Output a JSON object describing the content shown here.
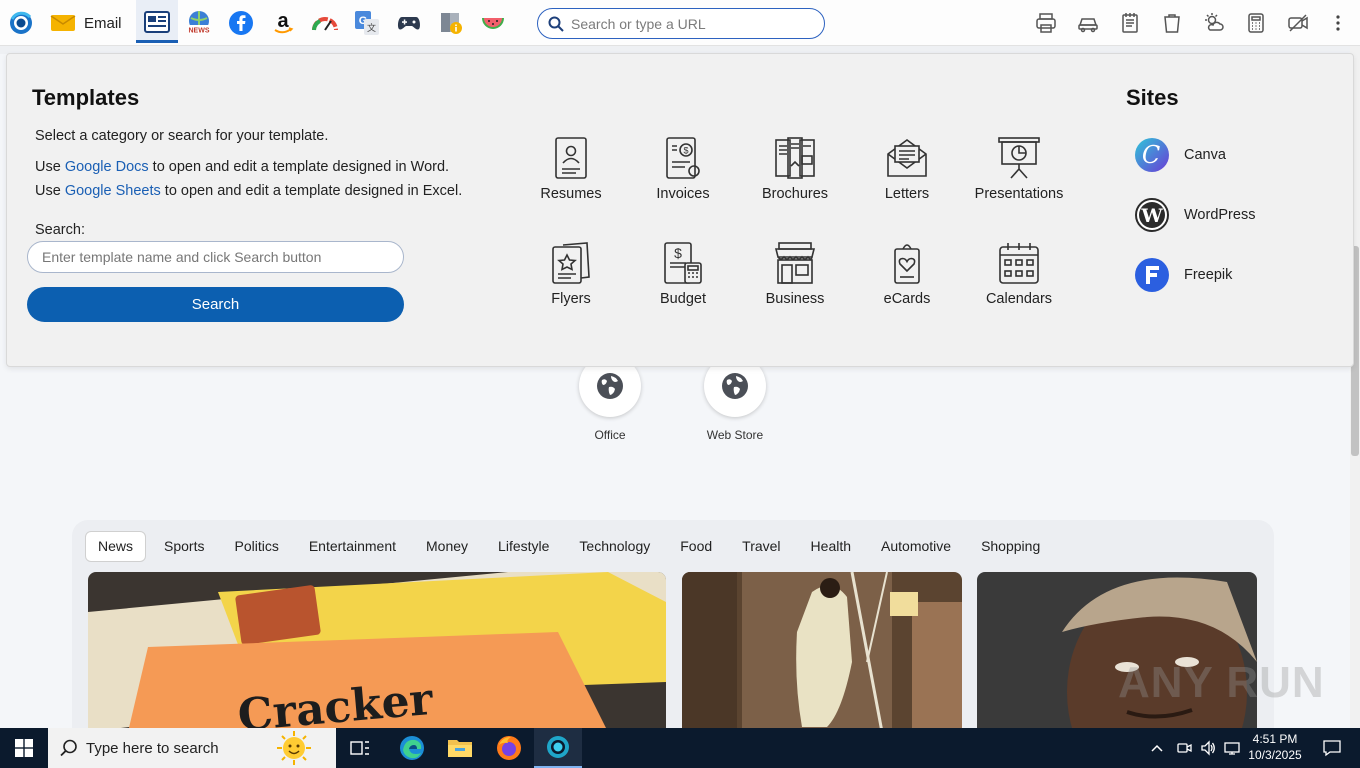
{
  "toolbar": {
    "email_label": "Email",
    "url_placeholder": "Search or type a URL"
  },
  "shortcuts": [
    {
      "label": "Office"
    },
    {
      "label": "Web Store"
    }
  ],
  "news": {
    "tabs": [
      "News",
      "Sports",
      "Politics",
      "Entertainment",
      "Money",
      "Lifestyle",
      "Technology",
      "Food",
      "Travel",
      "Health",
      "Automotive",
      "Shopping"
    ],
    "active_tab": "News"
  },
  "templates": {
    "title": "Templates",
    "intro": "Select a category or search for your template.",
    "docs_prefix": "Use ",
    "docs_link": "Google Docs",
    "docs_suffix": " to open and edit a template designed in Word.",
    "sheets_prefix": "Use ",
    "sheets_link": "Google Sheets",
    "sheets_suffix": " to open and edit a template designed in Excel.",
    "search_label": "Search:",
    "search_placeholder": "Enter template name and click Search button",
    "search_button": "Search",
    "categories": [
      {
        "label": "Resumes",
        "icon": "resume-icon"
      },
      {
        "label": "Invoices",
        "icon": "invoice-icon"
      },
      {
        "label": "Brochures",
        "icon": "brochure-icon"
      },
      {
        "label": "Letters",
        "icon": "letter-icon"
      },
      {
        "label": "Presentations",
        "icon": "presentation-icon"
      },
      {
        "label": "Flyers",
        "icon": "flyer-icon"
      },
      {
        "label": "Budget",
        "icon": "budget-icon"
      },
      {
        "label": "Business",
        "icon": "business-icon"
      },
      {
        "label": "eCards",
        "icon": "ecard-icon"
      },
      {
        "label": "Calendars",
        "icon": "calendar-icon"
      }
    ]
  },
  "sites": {
    "title": "Sites",
    "items": [
      {
        "label": "Canva",
        "color": "#5b6cf0"
      },
      {
        "label": "WordPress",
        "color": "#2b2b2b"
      },
      {
        "label": "Freepik",
        "color": "#2b5fe0"
      }
    ]
  },
  "taskbar": {
    "search_placeholder": "Type here to search",
    "time": "4:51 PM",
    "date": "10/3/2025"
  },
  "watermark": "ANY RUN"
}
